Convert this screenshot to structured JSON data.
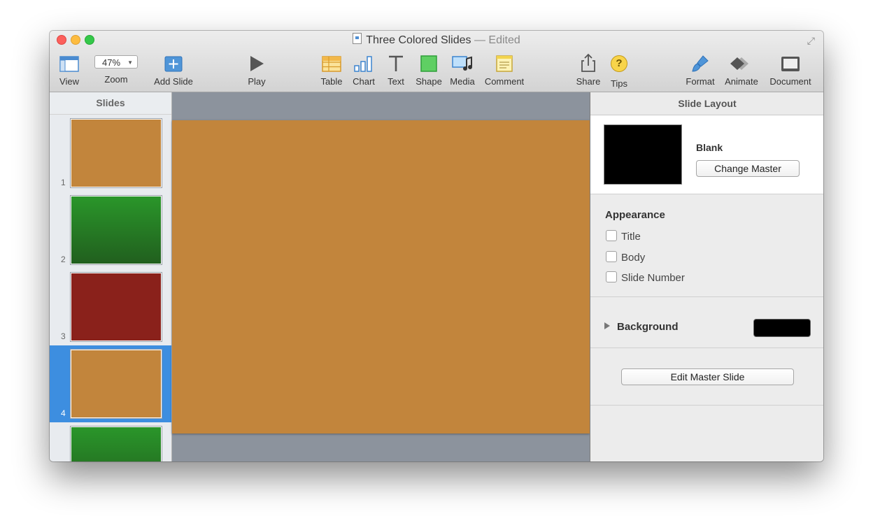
{
  "window": {
    "title": "Three Colored Slides",
    "title_status": "— Edited"
  },
  "toolbar": {
    "view_label": "View",
    "zoom_value": "47%",
    "zoom_label": "Zoom",
    "add_slide_label": "Add Slide",
    "play_label": "Play",
    "table_label": "Table",
    "chart_label": "Chart",
    "text_label": "Text",
    "shape_label": "Shape",
    "media_label": "Media",
    "comment_label": "Comment",
    "share_label": "Share",
    "tips_label": "Tips",
    "tips_glyph": "?",
    "format_label": "Format",
    "animate_label": "Animate",
    "document_label": "Document"
  },
  "sidebar": {
    "header": "Slides",
    "slides": [
      {
        "number": "1",
        "color": "#c2853c"
      },
      {
        "number": "2",
        "color": "#2a8a2a"
      },
      {
        "number": "3",
        "color": "#8a211b"
      },
      {
        "number": "4",
        "color": "#c2853c"
      },
      {
        "number": "",
        "color": "#2a8a2a"
      }
    ]
  },
  "canvas": {
    "slide_color": "#c2853c"
  },
  "inspector": {
    "header": "Slide Layout",
    "master_name": "Blank",
    "change_master_label": "Change Master",
    "appearance_title": "Appearance",
    "options": [
      "Title",
      "Body",
      "Slide Number"
    ],
    "background_label": "Background",
    "background_color": "#000000",
    "edit_master_label": "Edit Master Slide"
  },
  "colors": {
    "selection": "#3d8ee0",
    "accent_blue": "#4f95d8"
  }
}
